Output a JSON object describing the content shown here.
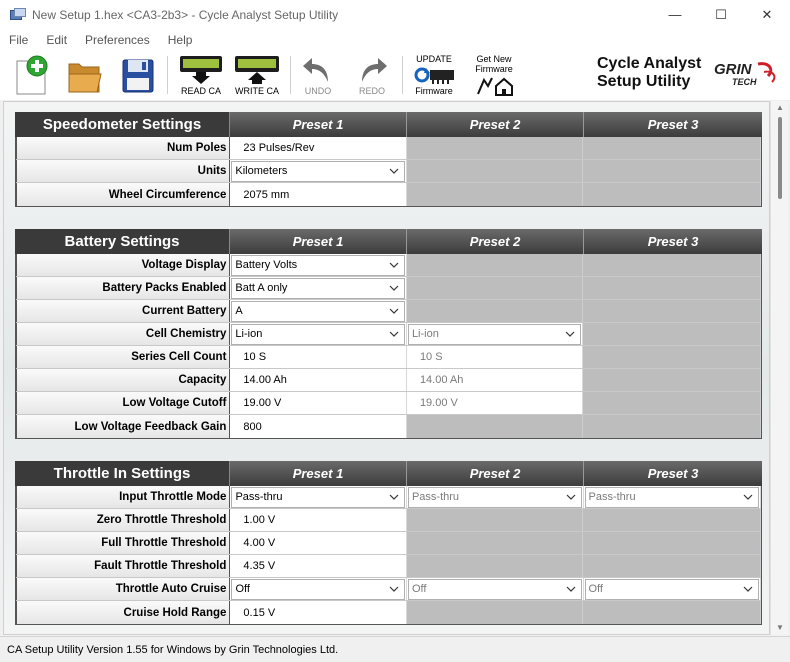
{
  "window": {
    "title": "New Setup 1.hex <CA3-2b3> - Cycle Analyst Setup Utility",
    "minimize": "—",
    "maximize": "☐",
    "close": "✕"
  },
  "menu": [
    "File",
    "Edit",
    "Preferences",
    "Help"
  ],
  "toolbar": {
    "read_ca": "READ CA",
    "write_ca": "WRITE CA",
    "undo": "UNDO",
    "redo": "REDO",
    "update_top": "UPDATE",
    "update_bottom": "Firmware",
    "get_new_line1": "Get New",
    "get_new_line2": "Firmware"
  },
  "brand": {
    "line1": "Cycle Analyst",
    "line2": "Setup Utility",
    "logo_text1": "GRIN",
    "logo_text2": "TECH"
  },
  "presets": [
    "Preset 1",
    "Preset 2",
    "Preset 3"
  ],
  "speedometer": {
    "title": "Speedometer Settings",
    "rows": [
      {
        "label": "Num Poles",
        "p1": "23 Pulses/Rev"
      },
      {
        "label": "Units",
        "p1": "Kilometers"
      },
      {
        "label": "Wheel Circumference",
        "p1": "2075 mm"
      }
    ]
  },
  "battery": {
    "title": "Battery Settings",
    "rows": [
      {
        "label": "Voltage Display",
        "p1": "Battery Volts"
      },
      {
        "label": "Battery Packs Enabled",
        "p1": "Batt A only"
      },
      {
        "label": "Current Battery",
        "p1": "A"
      },
      {
        "label": "Cell Chemistry",
        "p1": "Li-ion",
        "p2": "Li-ion"
      },
      {
        "label": "Series Cell Count",
        "p1": "10 S",
        "p2": "10 S"
      },
      {
        "label": "Capacity",
        "p1": "14.00 Ah",
        "p2": "14.00 Ah"
      },
      {
        "label": "Low Voltage Cutoff",
        "p1": "19.00 V",
        "p2": "19.00 V"
      },
      {
        "label": "Low Voltage Feedback Gain",
        "p1": "800"
      }
    ]
  },
  "throttle": {
    "title": "Throttle In Settings",
    "rows": [
      {
        "label": "Input Throttle Mode",
        "p1": "Pass-thru",
        "p2": "Pass-thru",
        "p3": "Pass-thru"
      },
      {
        "label": "Zero Throttle Threshold",
        "p1": "1.00 V"
      },
      {
        "label": "Full Throttle Threshold",
        "p1": "4.00 V"
      },
      {
        "label": "Fault Throttle Threshold",
        "p1": "4.35 V"
      },
      {
        "label": "Throttle Auto Cruise",
        "p1": "Off",
        "p2": "Off",
        "p3": "Off"
      },
      {
        "label": "Cruise Hold Range",
        "p1": "0.15 V"
      }
    ]
  },
  "status": "CA Setup Utility Version 1.55 for Windows by Grin Technologies Ltd.",
  "colors": {
    "header_dark": "#3a3a3a",
    "disabled_cell": "#bdbdbd",
    "new_icon_green": "#2fa533",
    "folder_orange": "#e0a040",
    "save_blue": "#2a4fa0"
  }
}
